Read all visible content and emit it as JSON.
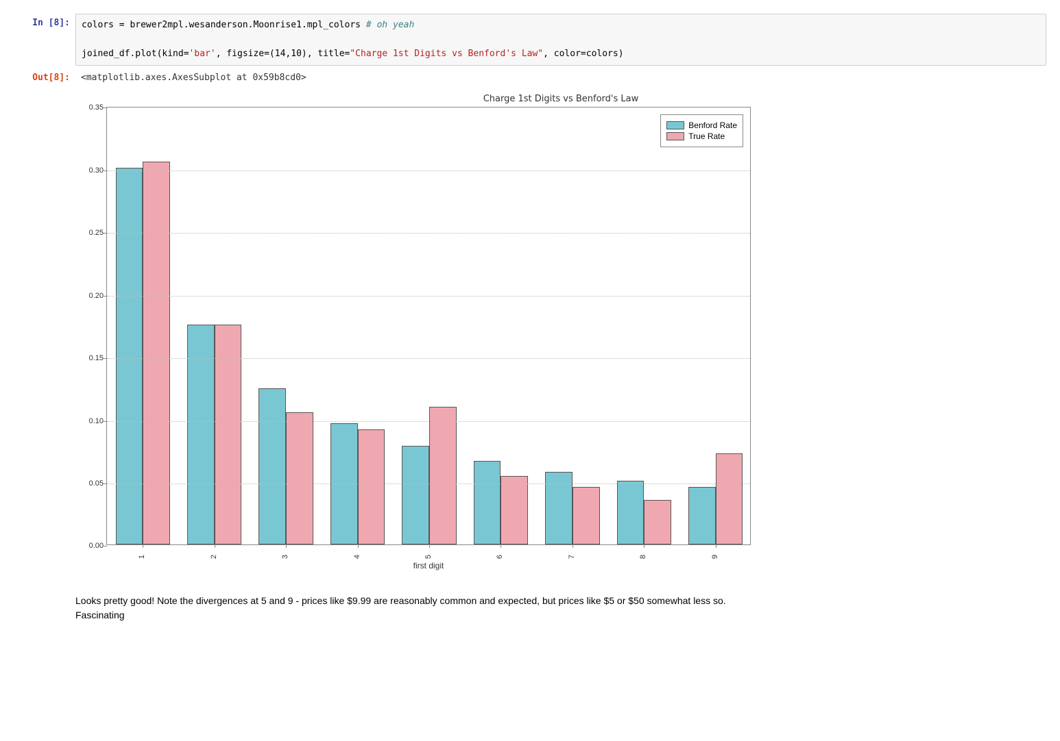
{
  "cell": {
    "in_prompt": "In [8]:",
    "out_prompt": "Out[8]:",
    "code_line1_pre": "colors = brewer2mpl.wesanderson.Moonrise1.mpl_colors ",
    "code_line1_cmt": "# oh yeah",
    "code_line2_pre": "joined_df.plot(kind=",
    "code_line2_str1": "'bar'",
    "code_line2_mid1": ", figsize=(14,10), title=",
    "code_line2_str2": "\"Charge 1st Digits vs Benford's Law\"",
    "code_line2_post": ", color=colors)",
    "output_repr": "<matplotlib.axes.AxesSubplot at 0x59b8cd0>"
  },
  "chart_data": {
    "type": "bar",
    "title": "Charge 1st Digits vs Benford's Law",
    "xlabel": "first digit",
    "ylabel": "",
    "ylim": [
      0,
      0.35
    ],
    "yticks": [
      0.0,
      0.05,
      0.1,
      0.15,
      0.2,
      0.25,
      0.3,
      0.35
    ],
    "ytick_labels": [
      "0.00",
      "0.05",
      "0.10",
      "0.15",
      "0.20",
      "0.25",
      "0.30",
      "0.35"
    ],
    "categories": [
      "1",
      "2",
      "3",
      "4",
      "5",
      "6",
      "7",
      "8",
      "9"
    ],
    "series": [
      {
        "name": "Benford Rate",
        "color": "#7ac7d4",
        "values": [
          0.301,
          0.176,
          0.125,
          0.097,
          0.079,
          0.067,
          0.058,
          0.051,
          0.046
        ]
      },
      {
        "name": "True Rate",
        "color": "#efa8b0",
        "values": [
          0.306,
          0.176,
          0.106,
          0.092,
          0.11,
          0.055,
          0.046,
          0.036,
          0.073
        ]
      }
    ],
    "legend_position": "upper right"
  },
  "commentary": {
    "line1": "Looks pretty good! Note the divergences at 5 and 9 - prices like $9.99 are reasonably common and expected, but prices like $5 or $50 somewhat less so.",
    "line2": "Fascinating"
  }
}
